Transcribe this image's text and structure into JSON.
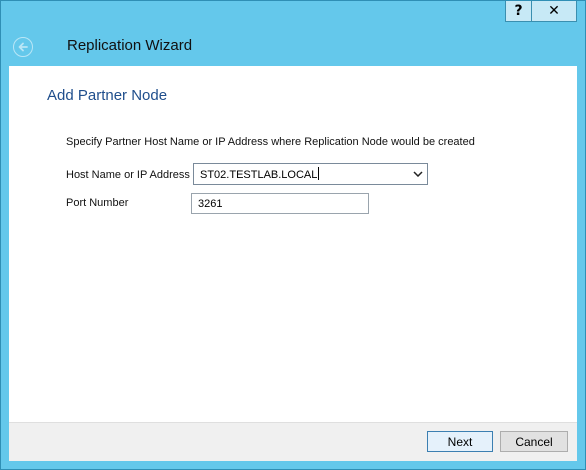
{
  "window": {
    "help_label": "?",
    "close_label": "✕",
    "title": "Replication Wizard"
  },
  "page": {
    "title": "Add Partner Node",
    "instruction": "Specify Partner Host Name or IP Address where Replication Node would be created"
  },
  "form": {
    "host_label": "Host Name or IP Address",
    "host_value": "ST02.TESTLAB.LOCAL",
    "port_label": "Port Number",
    "port_value": "3261"
  },
  "buttons": {
    "next": "Next",
    "cancel": "Cancel"
  },
  "colors": {
    "chrome": "#64c8eb",
    "page_title": "#1f4e8c",
    "default_button_border": "#3c7fb1"
  },
  "icons": {
    "back": "back-arrow-icon",
    "dropdown": "chevron-down-icon"
  }
}
